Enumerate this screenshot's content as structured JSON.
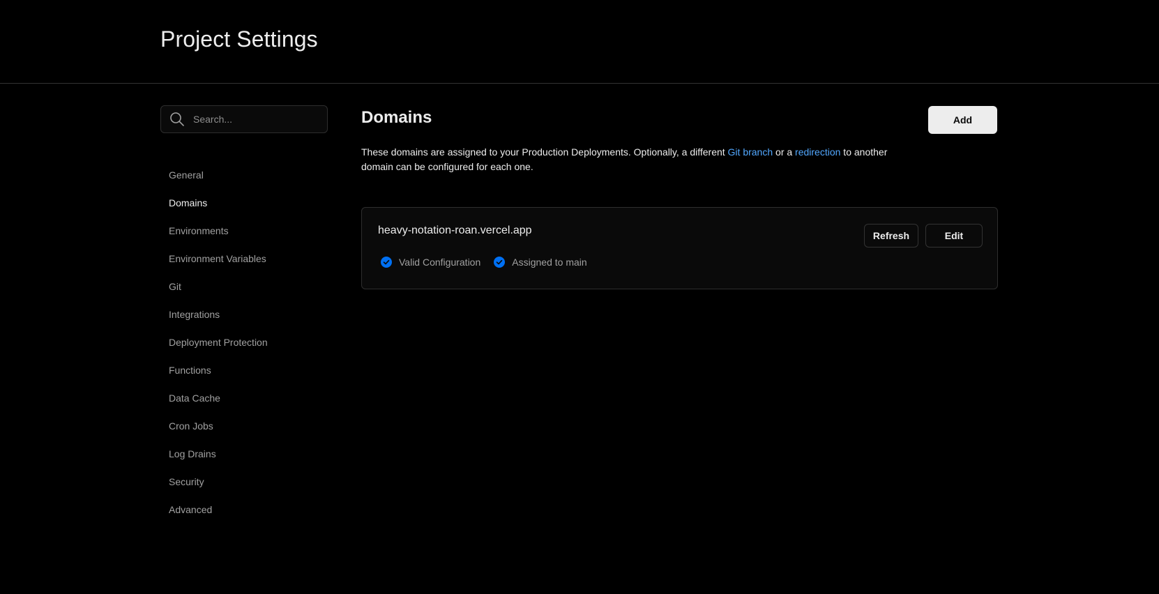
{
  "header": {
    "title": "Project Settings"
  },
  "search": {
    "placeholder": "Search..."
  },
  "sidebar": {
    "items": [
      {
        "label": "General"
      },
      {
        "label": "Domains"
      },
      {
        "label": "Environments"
      },
      {
        "label": "Environment Variables"
      },
      {
        "label": "Git"
      },
      {
        "label": "Integrations"
      },
      {
        "label": "Deployment Protection"
      },
      {
        "label": "Functions"
      },
      {
        "label": "Data Cache"
      },
      {
        "label": "Cron Jobs"
      },
      {
        "label": "Log Drains"
      },
      {
        "label": "Security"
      },
      {
        "label": "Advanced"
      }
    ],
    "active": "Domains"
  },
  "main": {
    "title": "Domains",
    "add_label": "Add",
    "description": {
      "part1": "These domains are assigned to your Production Deployments. Optionally, a different ",
      "link1": "Git branch",
      "part2": " or a ",
      "link2": "redirection",
      "part3": " to another domain can be configured for each one."
    },
    "domain": {
      "name": "heavy-notation-roan.vercel.app",
      "refresh_label": "Refresh",
      "edit_label": "Edit",
      "statuses": [
        {
          "label": "Valid Configuration",
          "icon": "check-circle-icon"
        },
        {
          "label": "Assigned to main",
          "icon": "check-circle-icon"
        }
      ]
    }
  },
  "colors": {
    "background": "#000000",
    "text": "#ededed",
    "muted": "#a1a1a1",
    "link": "#52a8ff",
    "check": "#0070f3"
  }
}
